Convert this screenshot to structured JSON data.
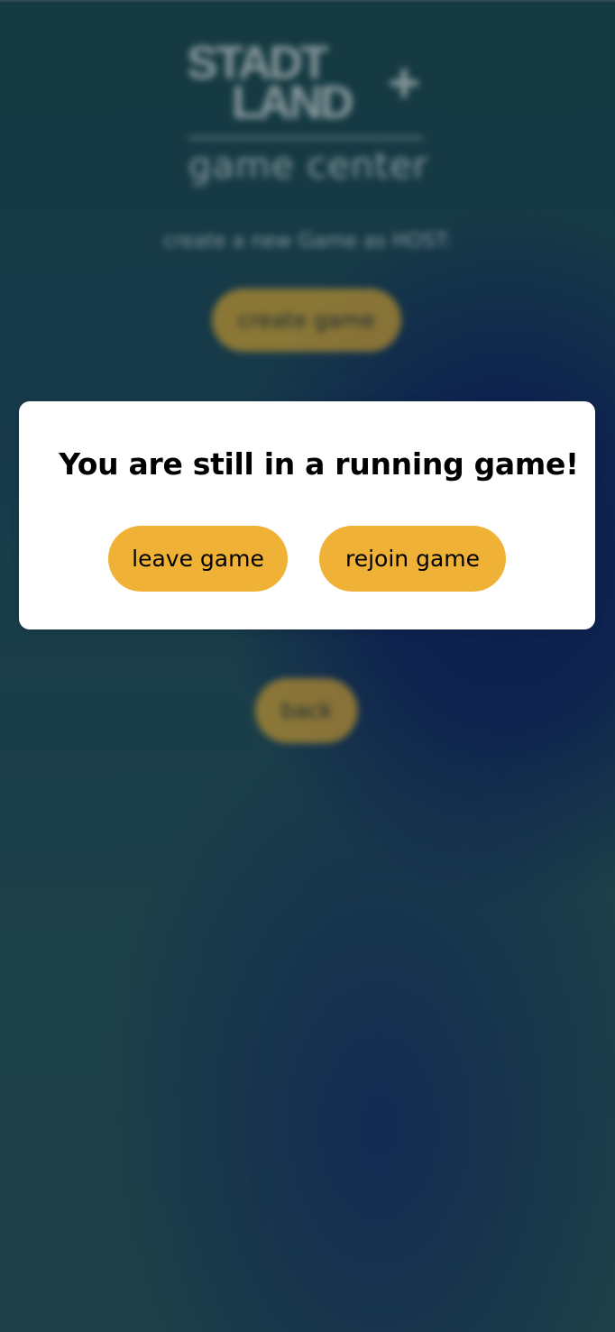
{
  "background": {
    "logo": {
      "line1": "STADT",
      "line2": "LAND",
      "plus": "+",
      "subtitle": "game center"
    },
    "hint": "create a new Game as HOST:",
    "create_button": "create game",
    "back_button": "back"
  },
  "modal": {
    "title": "You are still in a running game!",
    "leave_button": "leave game",
    "rejoin_button": "rejoin game"
  },
  "colors": {
    "accent": "#efb236",
    "modal_bg": "#ffffff",
    "page_bg_dark": "#0c1f4f",
    "page_bg_teal": "#1e4147"
  }
}
